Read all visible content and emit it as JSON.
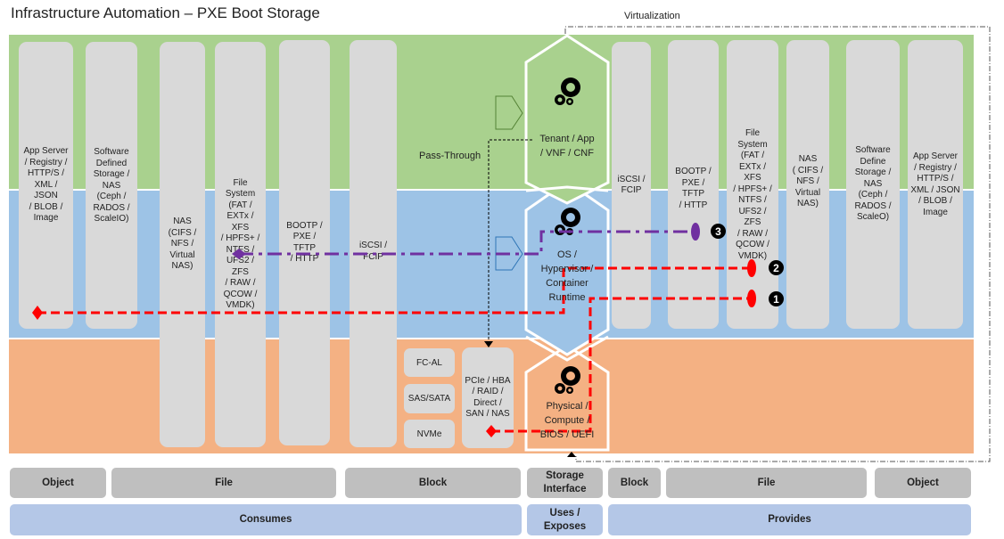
{
  "title": "Infrastructure Automation – PXE Boot Storage",
  "virtualization_label": "Virtualization",
  "pass_through_label": "Pass-Through",
  "layers": {
    "tenant": "Tenant / App\n/ VNF / CNF",
    "os": "OS /\nHypervisor /\nContainer\nRuntime",
    "physical": "Physical /\nCompute /\nBIOS / UEFI"
  },
  "consumes_columns": [
    {
      "id": "app-server-left",
      "label": "App Server\n/ Registry /\nHTTP/S /\nXML / JSON\n/ BLOB /\nImage"
    },
    {
      "id": "sds-left",
      "label": "Software\nDefined\nStorage /\nNAS\n(Ceph /\nRADOS /\nScaleIO)"
    },
    {
      "id": "nas-left",
      "label": "NAS\n(CIFS /\nNFS /\nVirtual\nNAS)"
    },
    {
      "id": "fs-left",
      "label": "File\nSystem\n(FAT /\nEXTx / XFS\n/ HPFS+ /\nNTFS /\nUFS2 / ZFS\n/ RAW /\nQCOW /\nVMDK)"
    },
    {
      "id": "bootp-left",
      "label": "BOOTP /\nPXE / TFTP\n/ HTTP"
    },
    {
      "id": "iscsi-left",
      "label": "iSCSI /\nFCIP"
    }
  ],
  "block_interfaces": [
    {
      "id": "fc-al",
      "label": "FC-AL"
    },
    {
      "id": "sas-sata",
      "label": "SAS/SATA"
    },
    {
      "id": "nvme",
      "label": "NVMe"
    }
  ],
  "pcie_box": "PCIe / HBA\n/ RAID /\nDirect /\nSAN / NAS",
  "provides_columns": [
    {
      "id": "iscsi-right",
      "label": "iSCSI /\nFCIP"
    },
    {
      "id": "bootp-right",
      "label": "BOOTP /\nPXE / TFTP\n/ HTTP"
    },
    {
      "id": "fs-right",
      "label": "File\nSystem\n(FAT /\nEXTx / XFS\n/ HPFS+ /\nNTFS /\nUFS2 / ZFS\n/  RAW /\nQCOW /\nVMDK)"
    },
    {
      "id": "nas-right",
      "label": "NAS\n( CIFS /\nNFS /\nVirtual\nNAS)"
    },
    {
      "id": "sds-right",
      "label": "Software\nDefine\nStorage /\nNAS\n(Ceph /\nRADOS  /\nScaleO)"
    },
    {
      "id": "app-server-right",
      "label": "App Server\n/ Registry /\nHTTP/S /\nXML / JSON\n/ BLOB /\nImage"
    }
  ],
  "steps": [
    {
      "number": "1",
      "color": "#ff0000"
    },
    {
      "number": "2",
      "color": "#ff0000"
    },
    {
      "number": "3",
      "color": "#7030a0"
    }
  ],
  "footer": {
    "row1": {
      "object_left": "Object",
      "file_left": "File",
      "block_left": "Block",
      "storage_interface": "Storage\nInterface",
      "block_right": "Block",
      "file_right": "File",
      "object_right": "Object"
    },
    "row2": {
      "consumes": "Consumes",
      "uses_exposes": "Uses /\nExposes",
      "provides": "Provides"
    }
  },
  "colors": {
    "tenant_band": "#a9d18e",
    "os_band": "#9dc3e6",
    "physical_band": "#f4b183",
    "path_red": "#ff0000",
    "path_purple": "#7030a0"
  }
}
